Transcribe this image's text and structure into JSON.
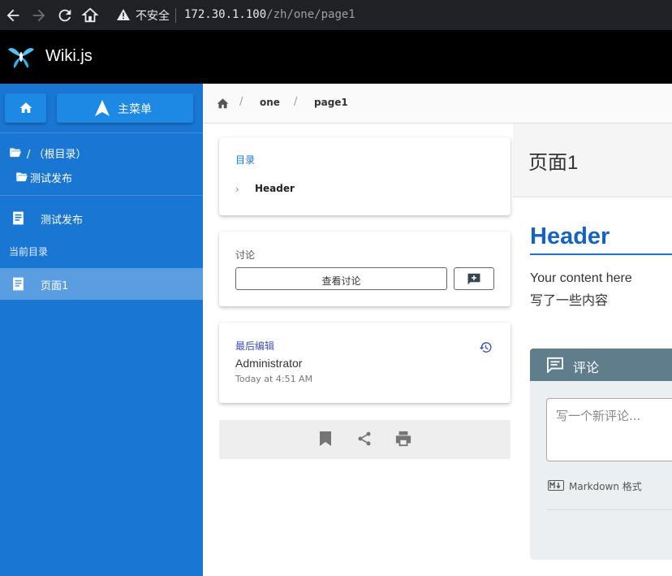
{
  "browser": {
    "insecure_label": "不安全",
    "url_host": "172.30.1.100",
    "url_path": "/zh/one/page1"
  },
  "app": {
    "title": "Wiki.js"
  },
  "sidebar": {
    "main_menu_label": "主菜单",
    "root_folder": "/ （根目录）",
    "sub_folder": "测试发布",
    "nav_item": "测试发布",
    "current_section": "当前目录",
    "current_item": "页面1"
  },
  "breadcrumb": {
    "items": [
      "one",
      "page1"
    ]
  },
  "page": {
    "title": "页面1",
    "heading": "Header",
    "paragraph1": "Your content here",
    "paragraph2": "写了一些内容"
  },
  "toc": {
    "heading": "目录",
    "items": [
      "Header"
    ]
  },
  "discussion": {
    "heading": "讨论",
    "view_button": "查看讨论"
  },
  "last_edit": {
    "heading": "最后编辑",
    "user": "Administrator",
    "time": "Today at 4:51 AM"
  },
  "comments": {
    "heading": "评论",
    "placeholder": "写一个新评论...",
    "markdown_label": "Markdown 格式"
  },
  "colors": {
    "sidebar": "#1976d2",
    "accent": "#1565c0",
    "comments_header": "#607d8b"
  }
}
